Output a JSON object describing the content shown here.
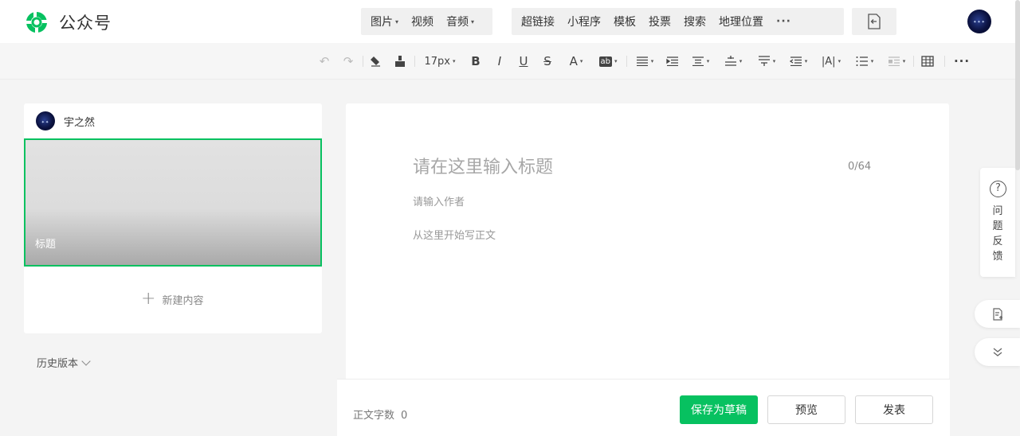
{
  "header": {
    "brand": "公众号",
    "insert_menu": [
      {
        "label": "图片",
        "has_caret": true
      },
      {
        "label": "视频",
        "has_caret": false
      },
      {
        "label": "音频",
        "has_caret": true
      }
    ],
    "insert_menu_2": [
      {
        "label": "超链接"
      },
      {
        "label": "小程序"
      },
      {
        "label": "模板"
      },
      {
        "label": "投票"
      },
      {
        "label": "搜索"
      },
      {
        "label": "地理位置"
      }
    ],
    "more_icon": "more-icon",
    "import_icon": "import-document-icon",
    "brand_color": "#07c160"
  },
  "toolbar": {
    "font_size": "17px",
    "icons": [
      "undo-icon",
      "redo-icon",
      "clear-format-icon",
      "format-painter-icon",
      "bold-icon",
      "italic-icon",
      "underline-icon",
      "strikethrough-icon",
      "font-color-icon",
      "background-color-icon",
      "align-icon",
      "indent-icon",
      "line-spacing-icon",
      "paragraph-spacing-icon",
      "vertical-spacing-icon",
      "text-indent-icon",
      "letter-spacing-icon",
      "list-icon",
      "table-format-icon",
      "table-icon",
      "more-icon"
    ]
  },
  "left_panel": {
    "account_name": "宇之然",
    "article_title": "标题",
    "new_content": "新建内容",
    "history": "历史版本"
  },
  "editor": {
    "title_placeholder": "请在这里输入标题",
    "title_count": "0/64",
    "author_placeholder": "请输入作者",
    "body_placeholder": "从这里开始写正文"
  },
  "bottom_bar": {
    "word_count_label": "正文字数",
    "word_count_value": "0",
    "save_draft": "保存为草稿",
    "preview": "预览",
    "publish": "发表"
  },
  "side": {
    "feedback_label": "问题反馈"
  }
}
